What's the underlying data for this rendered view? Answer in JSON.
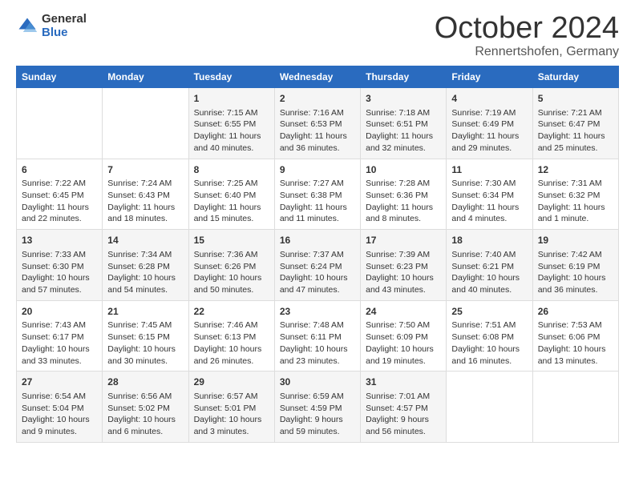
{
  "logo": {
    "general": "General",
    "blue": "Blue"
  },
  "title": "October 2024",
  "location": "Rennertshofen, Germany",
  "days_header": [
    "Sunday",
    "Monday",
    "Tuesday",
    "Wednesday",
    "Thursday",
    "Friday",
    "Saturday"
  ],
  "weeks": [
    [
      {
        "day": "",
        "lines": []
      },
      {
        "day": "",
        "lines": []
      },
      {
        "day": "1",
        "lines": [
          "Sunrise: 7:15 AM",
          "Sunset: 6:55 PM",
          "Daylight: 11 hours and 40 minutes."
        ]
      },
      {
        "day": "2",
        "lines": [
          "Sunrise: 7:16 AM",
          "Sunset: 6:53 PM",
          "Daylight: 11 hours and 36 minutes."
        ]
      },
      {
        "day": "3",
        "lines": [
          "Sunrise: 7:18 AM",
          "Sunset: 6:51 PM",
          "Daylight: 11 hours and 32 minutes."
        ]
      },
      {
        "day": "4",
        "lines": [
          "Sunrise: 7:19 AM",
          "Sunset: 6:49 PM",
          "Daylight: 11 hours and 29 minutes."
        ]
      },
      {
        "day": "5",
        "lines": [
          "Sunrise: 7:21 AM",
          "Sunset: 6:47 PM",
          "Daylight: 11 hours and 25 minutes."
        ]
      }
    ],
    [
      {
        "day": "6",
        "lines": [
          "Sunrise: 7:22 AM",
          "Sunset: 6:45 PM",
          "Daylight: 11 hours and 22 minutes."
        ]
      },
      {
        "day": "7",
        "lines": [
          "Sunrise: 7:24 AM",
          "Sunset: 6:43 PM",
          "Daylight: 11 hours and 18 minutes."
        ]
      },
      {
        "day": "8",
        "lines": [
          "Sunrise: 7:25 AM",
          "Sunset: 6:40 PM",
          "Daylight: 11 hours and 15 minutes."
        ]
      },
      {
        "day": "9",
        "lines": [
          "Sunrise: 7:27 AM",
          "Sunset: 6:38 PM",
          "Daylight: 11 hours and 11 minutes."
        ]
      },
      {
        "day": "10",
        "lines": [
          "Sunrise: 7:28 AM",
          "Sunset: 6:36 PM",
          "Daylight: 11 hours and 8 minutes."
        ]
      },
      {
        "day": "11",
        "lines": [
          "Sunrise: 7:30 AM",
          "Sunset: 6:34 PM",
          "Daylight: 11 hours and 4 minutes."
        ]
      },
      {
        "day": "12",
        "lines": [
          "Sunrise: 7:31 AM",
          "Sunset: 6:32 PM",
          "Daylight: 11 hours and 1 minute."
        ]
      }
    ],
    [
      {
        "day": "13",
        "lines": [
          "Sunrise: 7:33 AM",
          "Sunset: 6:30 PM",
          "Daylight: 10 hours and 57 minutes."
        ]
      },
      {
        "day": "14",
        "lines": [
          "Sunrise: 7:34 AM",
          "Sunset: 6:28 PM",
          "Daylight: 10 hours and 54 minutes."
        ]
      },
      {
        "day": "15",
        "lines": [
          "Sunrise: 7:36 AM",
          "Sunset: 6:26 PM",
          "Daylight: 10 hours and 50 minutes."
        ]
      },
      {
        "day": "16",
        "lines": [
          "Sunrise: 7:37 AM",
          "Sunset: 6:24 PM",
          "Daylight: 10 hours and 47 minutes."
        ]
      },
      {
        "day": "17",
        "lines": [
          "Sunrise: 7:39 AM",
          "Sunset: 6:23 PM",
          "Daylight: 10 hours and 43 minutes."
        ]
      },
      {
        "day": "18",
        "lines": [
          "Sunrise: 7:40 AM",
          "Sunset: 6:21 PM",
          "Daylight: 10 hours and 40 minutes."
        ]
      },
      {
        "day": "19",
        "lines": [
          "Sunrise: 7:42 AM",
          "Sunset: 6:19 PM",
          "Daylight: 10 hours and 36 minutes."
        ]
      }
    ],
    [
      {
        "day": "20",
        "lines": [
          "Sunrise: 7:43 AM",
          "Sunset: 6:17 PM",
          "Daylight: 10 hours and 33 minutes."
        ]
      },
      {
        "day": "21",
        "lines": [
          "Sunrise: 7:45 AM",
          "Sunset: 6:15 PM",
          "Daylight: 10 hours and 30 minutes."
        ]
      },
      {
        "day": "22",
        "lines": [
          "Sunrise: 7:46 AM",
          "Sunset: 6:13 PM",
          "Daylight: 10 hours and 26 minutes."
        ]
      },
      {
        "day": "23",
        "lines": [
          "Sunrise: 7:48 AM",
          "Sunset: 6:11 PM",
          "Daylight: 10 hours and 23 minutes."
        ]
      },
      {
        "day": "24",
        "lines": [
          "Sunrise: 7:50 AM",
          "Sunset: 6:09 PM",
          "Daylight: 10 hours and 19 minutes."
        ]
      },
      {
        "day": "25",
        "lines": [
          "Sunrise: 7:51 AM",
          "Sunset: 6:08 PM",
          "Daylight: 10 hours and 16 minutes."
        ]
      },
      {
        "day": "26",
        "lines": [
          "Sunrise: 7:53 AM",
          "Sunset: 6:06 PM",
          "Daylight: 10 hours and 13 minutes."
        ]
      }
    ],
    [
      {
        "day": "27",
        "lines": [
          "Sunrise: 6:54 AM",
          "Sunset: 5:04 PM",
          "Daylight: 10 hours and 9 minutes."
        ]
      },
      {
        "day": "28",
        "lines": [
          "Sunrise: 6:56 AM",
          "Sunset: 5:02 PM",
          "Daylight: 10 hours and 6 minutes."
        ]
      },
      {
        "day": "29",
        "lines": [
          "Sunrise: 6:57 AM",
          "Sunset: 5:01 PM",
          "Daylight: 10 hours and 3 minutes."
        ]
      },
      {
        "day": "30",
        "lines": [
          "Sunrise: 6:59 AM",
          "Sunset: 4:59 PM",
          "Daylight: 9 hours and 59 minutes."
        ]
      },
      {
        "day": "31",
        "lines": [
          "Sunrise: 7:01 AM",
          "Sunset: 4:57 PM",
          "Daylight: 9 hours and 56 minutes."
        ]
      },
      {
        "day": "",
        "lines": []
      },
      {
        "day": "",
        "lines": []
      }
    ]
  ]
}
